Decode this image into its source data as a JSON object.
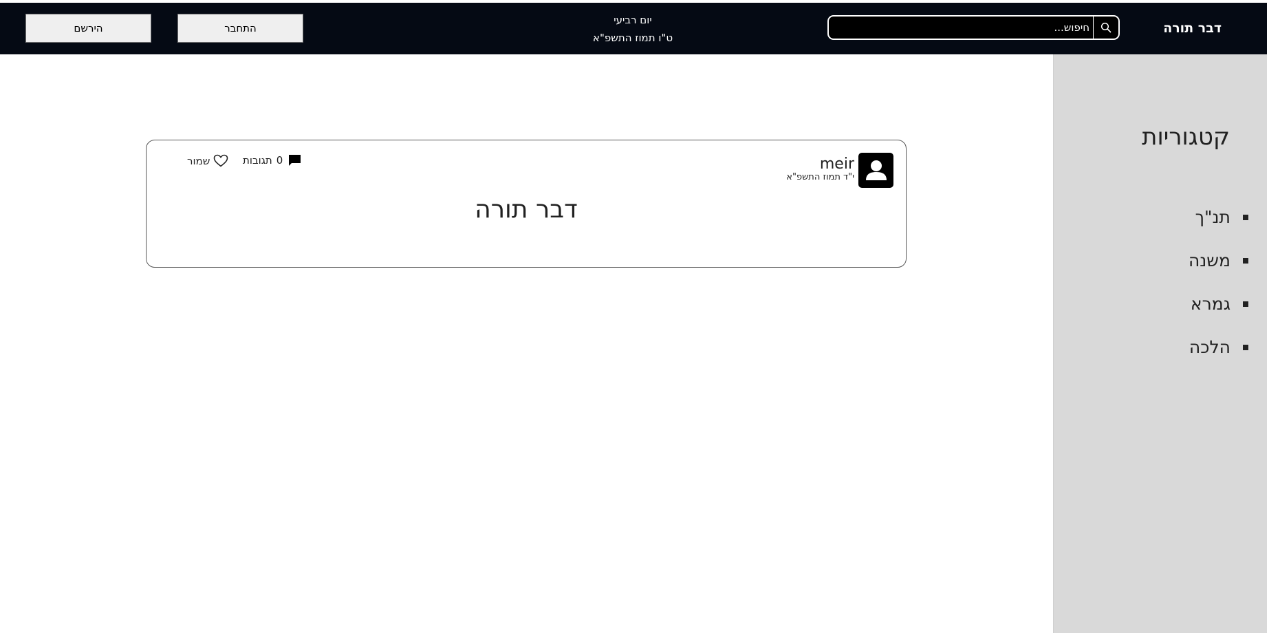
{
  "header": {
    "brand": "דבר תורה",
    "search": {
      "placeholder": "חיפוש...",
      "icon": "search-icon"
    },
    "date": {
      "weekday": "יום רביעי",
      "hebrew_date": "ט\"ו תמוז התשפ\"א"
    },
    "login_label": "התחבר",
    "register_label": "הירשם"
  },
  "sidebar": {
    "title": "קטגוריות",
    "items": [
      {
        "label": "תנ\"ך"
      },
      {
        "label": "משנה"
      },
      {
        "label": "גמרא"
      },
      {
        "label": "הלכה"
      }
    ]
  },
  "post": {
    "author": "meir",
    "date": "י\"ד תמוז התשפ\"א",
    "title": "דבר תורה",
    "comments_count": "0",
    "comments_label": "תגובות",
    "save_label": "שמור",
    "avatar_icon": "user-avatar-icon",
    "comment_icon": "comment-icon",
    "save_icon": "heart-icon"
  },
  "colors": {
    "header_bg": "#050a14",
    "sidebar_bg": "#d9d9d9",
    "text": "#212121"
  }
}
